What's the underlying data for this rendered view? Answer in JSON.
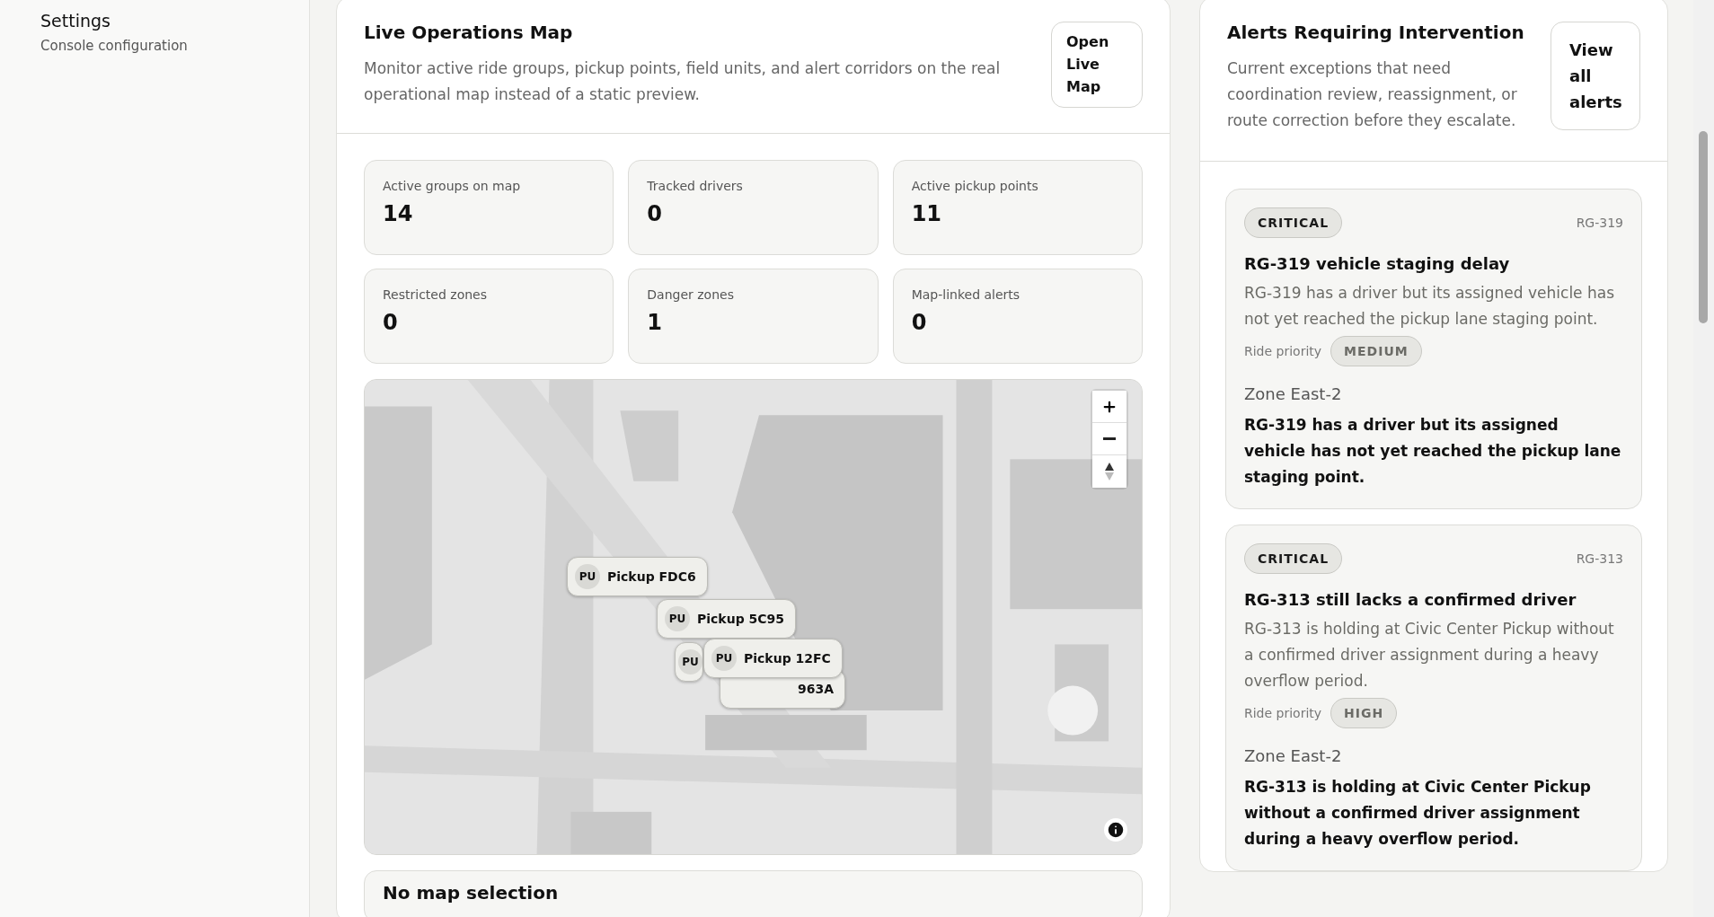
{
  "sidebar": {
    "title": "Settings",
    "subtitle": "Console configuration"
  },
  "map_panel": {
    "title": "Live Operations Map",
    "description": "Monitor active ride groups, pickup points, field units, and alert corridors on the real operational map instead of a static preview.",
    "button": "Open Live Map",
    "stats": [
      {
        "label": "Active groups on map",
        "value": "14"
      },
      {
        "label": "Tracked drivers",
        "value": "0"
      },
      {
        "label": "Active pickup points",
        "value": "11"
      },
      {
        "label": "Restricted zones",
        "value": "0"
      },
      {
        "label": "Danger zones",
        "value": "1"
      },
      {
        "label": "Map-linked alerts",
        "value": "0"
      }
    ],
    "map": {
      "kind": "picture",
      "markers": [
        {
          "badge": "PU",
          "label": "Pickup FDC6"
        },
        {
          "badge": "PU",
          "label": "Pickup 5C95"
        },
        {
          "badge": "PU"
        },
        {
          "label": "963A"
        },
        {
          "badge": "PU",
          "label": "Pickup 12FC"
        }
      ]
    },
    "selection": {
      "title": "No map selection"
    }
  },
  "alerts_panel": {
    "title": "Alerts Requiring Intervention",
    "description": "Current exceptions that need coordination review, reassignment, or route correction before they escalate.",
    "button": "View all alerts",
    "alerts": [
      {
        "severity": "CRITICAL",
        "id": "RG-319",
        "title": "RG-319 vehicle staging delay",
        "description": "RG-319 has a driver but its assigned vehicle has not yet reached the pickup lane staging point.",
        "priority_label": "Ride priority",
        "priority": "MEDIUM",
        "zone": "Zone East-2",
        "detail": "RG-319 has a driver but its assigned vehicle has not yet reached the pickup lane staging point."
      },
      {
        "severity": "CRITICAL",
        "id": "RG-313",
        "title": "RG-313 still lacks a confirmed driver",
        "description": "RG-313 is holding at Civic Center Pickup without a confirmed driver assignment during a heavy overflow period.",
        "priority_label": "Ride priority",
        "priority": "HIGH",
        "zone": "Zone East-2",
        "detail": "RG-313 is holding at Civic Center Pickup without a confirmed driver assignment during a heavy overflow period."
      }
    ]
  }
}
